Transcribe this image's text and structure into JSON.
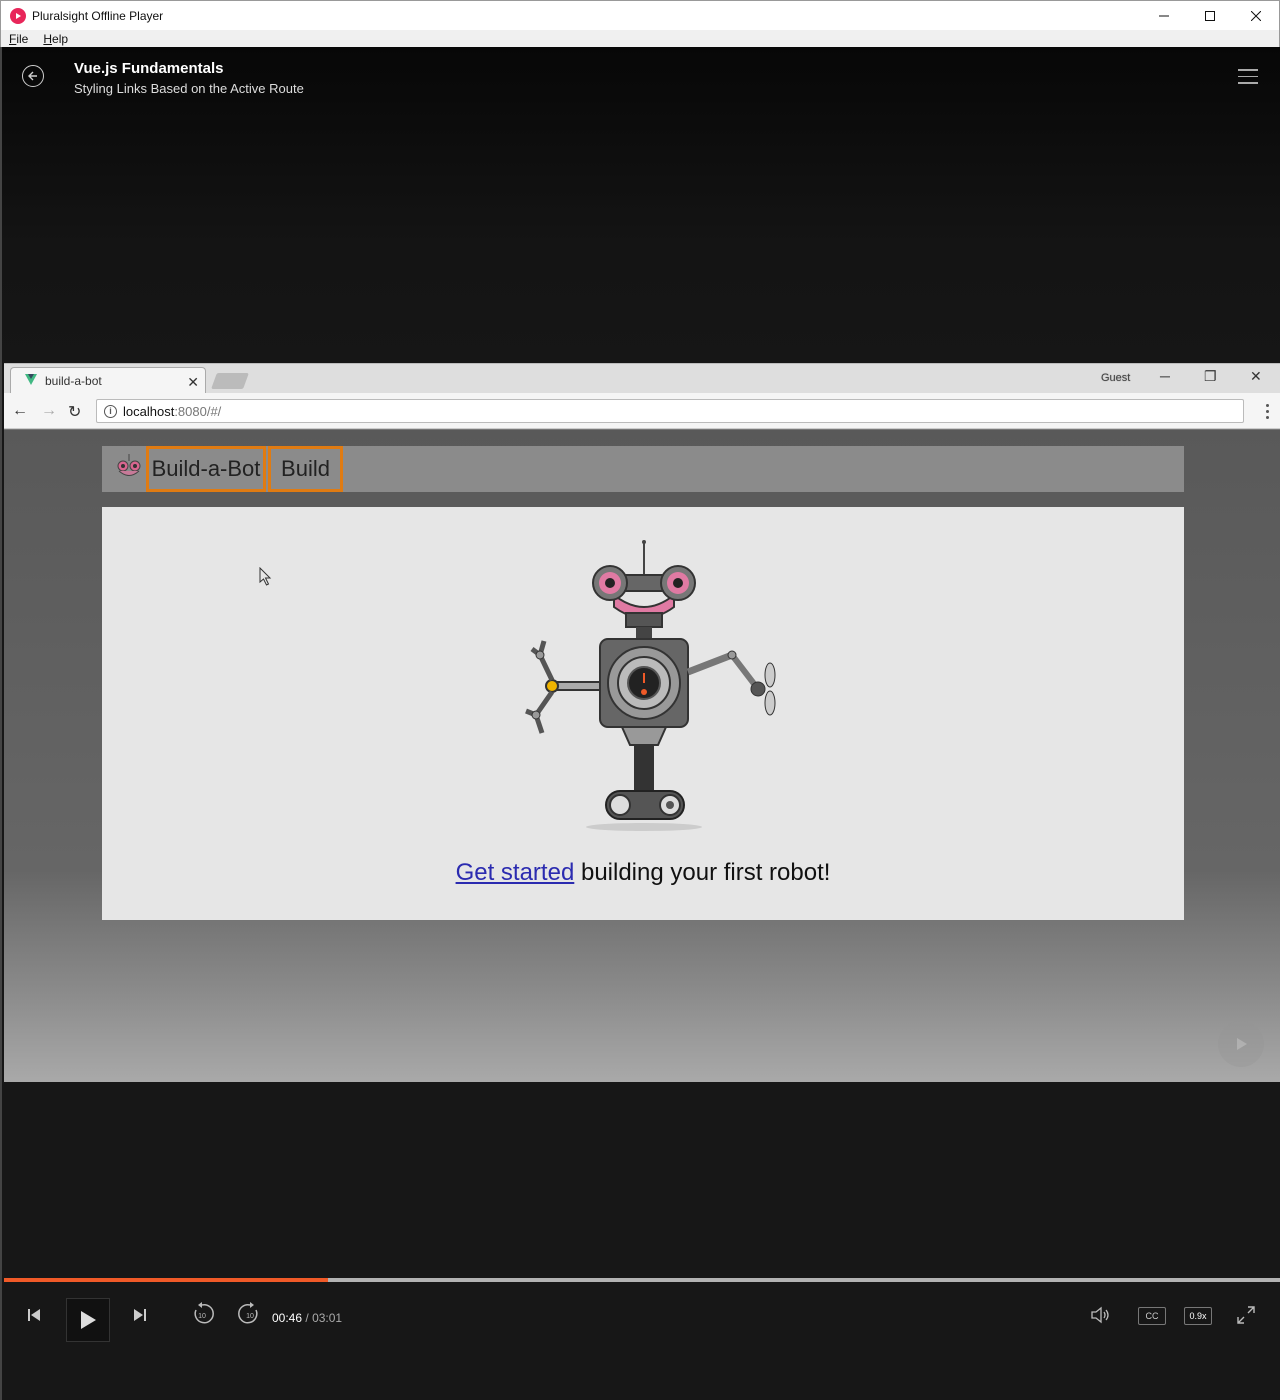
{
  "window": {
    "title": "Pluralsight Offline Player",
    "controls": {
      "minimize": "─",
      "maximize": "☐",
      "close": "✕"
    }
  },
  "menubar": {
    "items": [
      {
        "accel": "F",
        "rest": "ile"
      },
      {
        "accel": "H",
        "rest": "elp"
      }
    ]
  },
  "player_header": {
    "course_title": "Vue.js Fundamentals",
    "clip_title": "Styling Links Based on the Active Route"
  },
  "browser": {
    "tab_title": "build-a-bot",
    "profile_label": "Guest",
    "url_host": "localhost",
    "url_path": ":8080/#/",
    "info_glyph": "i"
  },
  "site": {
    "nav_links": [
      "Build-a-Bot",
      "Build"
    ],
    "cta_link": "Get started",
    "cta_rest": " building your first robot!"
  },
  "playback": {
    "current_time": "00:46",
    "separator": "/",
    "total_time": "03:01",
    "progress_fraction": 0.254,
    "skip_back_seconds": "10",
    "skip_forward_seconds": "10",
    "captions_label": "CC",
    "speed_label": "0.9x",
    "accent_color": "#f05a28"
  }
}
